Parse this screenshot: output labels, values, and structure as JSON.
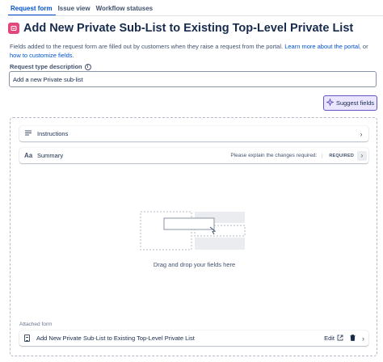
{
  "tabs": [
    {
      "label": "Request form",
      "active": true
    },
    {
      "label": "Issue view",
      "active": false
    },
    {
      "label": "Workflow statuses",
      "active": false
    }
  ],
  "header": {
    "title": "Add New Private Sub-List to Existing Top-Level Private List",
    "icon": "request-type-icon",
    "icon_color": "#e2467c"
  },
  "description": {
    "text": "Fields added to the request form are filled out by customers when they raise a request from the portal.",
    "link1": "Learn more about the portal",
    "or": ", or",
    "link2": "how to customize fields",
    "end": "."
  },
  "request_type_description": {
    "label": "Request type description",
    "value": "Add a new Private sub-list"
  },
  "suggest_button": {
    "label": "Suggest fields",
    "accent": "#6554c0"
  },
  "fields": [
    {
      "label": "Instructions",
      "icon": "text-lines-icon"
    },
    {
      "label": "Summary",
      "icon": "text-style-icon",
      "hint": "Please explain the changes required:",
      "badge": "REQUIRED"
    }
  ],
  "drop_zone": {
    "text": "Drag and drop your fields here"
  },
  "attached_form": {
    "label": "Attached form",
    "name": "Add New Private Sub-List to Existing Top-Level Private List",
    "edit_label": "Edit"
  }
}
